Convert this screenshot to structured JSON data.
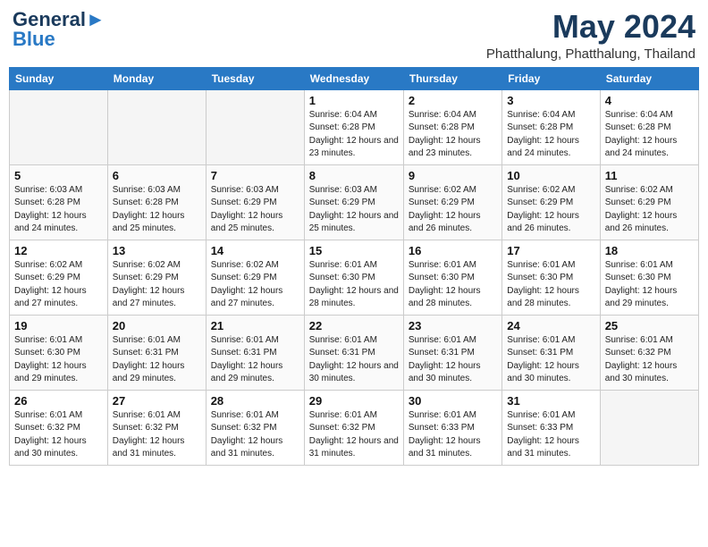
{
  "header": {
    "logo_general": "General",
    "logo_blue": "Blue",
    "month_year": "May 2024",
    "location": "Phatthalung, Phatthalung, Thailand"
  },
  "weekdays": [
    "Sunday",
    "Monday",
    "Tuesday",
    "Wednesday",
    "Thursday",
    "Friday",
    "Saturday"
  ],
  "weeks": [
    [
      {
        "day": "",
        "sunrise": "",
        "sunset": "",
        "daylight": "",
        "empty": true
      },
      {
        "day": "",
        "sunrise": "",
        "sunset": "",
        "daylight": "",
        "empty": true
      },
      {
        "day": "",
        "sunrise": "",
        "sunset": "",
        "daylight": "",
        "empty": true
      },
      {
        "day": "1",
        "sunrise": "Sunrise: 6:04 AM",
        "sunset": "Sunset: 6:28 PM",
        "daylight": "Daylight: 12 hours and 23 minutes."
      },
      {
        "day": "2",
        "sunrise": "Sunrise: 6:04 AM",
        "sunset": "Sunset: 6:28 PM",
        "daylight": "Daylight: 12 hours and 23 minutes."
      },
      {
        "day": "3",
        "sunrise": "Sunrise: 6:04 AM",
        "sunset": "Sunset: 6:28 PM",
        "daylight": "Daylight: 12 hours and 24 minutes."
      },
      {
        "day": "4",
        "sunrise": "Sunrise: 6:04 AM",
        "sunset": "Sunset: 6:28 PM",
        "daylight": "Daylight: 12 hours and 24 minutes."
      }
    ],
    [
      {
        "day": "5",
        "sunrise": "Sunrise: 6:03 AM",
        "sunset": "Sunset: 6:28 PM",
        "daylight": "Daylight: 12 hours and 24 minutes."
      },
      {
        "day": "6",
        "sunrise": "Sunrise: 6:03 AM",
        "sunset": "Sunset: 6:28 PM",
        "daylight": "Daylight: 12 hours and 25 minutes."
      },
      {
        "day": "7",
        "sunrise": "Sunrise: 6:03 AM",
        "sunset": "Sunset: 6:29 PM",
        "daylight": "Daylight: 12 hours and 25 minutes."
      },
      {
        "day": "8",
        "sunrise": "Sunrise: 6:03 AM",
        "sunset": "Sunset: 6:29 PM",
        "daylight": "Daylight: 12 hours and 25 minutes."
      },
      {
        "day": "9",
        "sunrise": "Sunrise: 6:02 AM",
        "sunset": "Sunset: 6:29 PM",
        "daylight": "Daylight: 12 hours and 26 minutes."
      },
      {
        "day": "10",
        "sunrise": "Sunrise: 6:02 AM",
        "sunset": "Sunset: 6:29 PM",
        "daylight": "Daylight: 12 hours and 26 minutes."
      },
      {
        "day": "11",
        "sunrise": "Sunrise: 6:02 AM",
        "sunset": "Sunset: 6:29 PM",
        "daylight": "Daylight: 12 hours and 26 minutes."
      }
    ],
    [
      {
        "day": "12",
        "sunrise": "Sunrise: 6:02 AM",
        "sunset": "Sunset: 6:29 PM",
        "daylight": "Daylight: 12 hours and 27 minutes."
      },
      {
        "day": "13",
        "sunrise": "Sunrise: 6:02 AM",
        "sunset": "Sunset: 6:29 PM",
        "daylight": "Daylight: 12 hours and 27 minutes."
      },
      {
        "day": "14",
        "sunrise": "Sunrise: 6:02 AM",
        "sunset": "Sunset: 6:29 PM",
        "daylight": "Daylight: 12 hours and 27 minutes."
      },
      {
        "day": "15",
        "sunrise": "Sunrise: 6:01 AM",
        "sunset": "Sunset: 6:30 PM",
        "daylight": "Daylight: 12 hours and 28 minutes."
      },
      {
        "day": "16",
        "sunrise": "Sunrise: 6:01 AM",
        "sunset": "Sunset: 6:30 PM",
        "daylight": "Daylight: 12 hours and 28 minutes."
      },
      {
        "day": "17",
        "sunrise": "Sunrise: 6:01 AM",
        "sunset": "Sunset: 6:30 PM",
        "daylight": "Daylight: 12 hours and 28 minutes."
      },
      {
        "day": "18",
        "sunrise": "Sunrise: 6:01 AM",
        "sunset": "Sunset: 6:30 PM",
        "daylight": "Daylight: 12 hours and 29 minutes."
      }
    ],
    [
      {
        "day": "19",
        "sunrise": "Sunrise: 6:01 AM",
        "sunset": "Sunset: 6:30 PM",
        "daylight": "Daylight: 12 hours and 29 minutes."
      },
      {
        "day": "20",
        "sunrise": "Sunrise: 6:01 AM",
        "sunset": "Sunset: 6:31 PM",
        "daylight": "Daylight: 12 hours and 29 minutes."
      },
      {
        "day": "21",
        "sunrise": "Sunrise: 6:01 AM",
        "sunset": "Sunset: 6:31 PM",
        "daylight": "Daylight: 12 hours and 29 minutes."
      },
      {
        "day": "22",
        "sunrise": "Sunrise: 6:01 AM",
        "sunset": "Sunset: 6:31 PM",
        "daylight": "Daylight: 12 hours and 30 minutes."
      },
      {
        "day": "23",
        "sunrise": "Sunrise: 6:01 AM",
        "sunset": "Sunset: 6:31 PM",
        "daylight": "Daylight: 12 hours and 30 minutes."
      },
      {
        "day": "24",
        "sunrise": "Sunrise: 6:01 AM",
        "sunset": "Sunset: 6:31 PM",
        "daylight": "Daylight: 12 hours and 30 minutes."
      },
      {
        "day": "25",
        "sunrise": "Sunrise: 6:01 AM",
        "sunset": "Sunset: 6:32 PM",
        "daylight": "Daylight: 12 hours and 30 minutes."
      }
    ],
    [
      {
        "day": "26",
        "sunrise": "Sunrise: 6:01 AM",
        "sunset": "Sunset: 6:32 PM",
        "daylight": "Daylight: 12 hours and 30 minutes."
      },
      {
        "day": "27",
        "sunrise": "Sunrise: 6:01 AM",
        "sunset": "Sunset: 6:32 PM",
        "daylight": "Daylight: 12 hours and 31 minutes."
      },
      {
        "day": "28",
        "sunrise": "Sunrise: 6:01 AM",
        "sunset": "Sunset: 6:32 PM",
        "daylight": "Daylight: 12 hours and 31 minutes."
      },
      {
        "day": "29",
        "sunrise": "Sunrise: 6:01 AM",
        "sunset": "Sunset: 6:32 PM",
        "daylight": "Daylight: 12 hours and 31 minutes."
      },
      {
        "day": "30",
        "sunrise": "Sunrise: 6:01 AM",
        "sunset": "Sunset: 6:33 PM",
        "daylight": "Daylight: 12 hours and 31 minutes."
      },
      {
        "day": "31",
        "sunrise": "Sunrise: 6:01 AM",
        "sunset": "Sunset: 6:33 PM",
        "daylight": "Daylight: 12 hours and 31 minutes."
      },
      {
        "day": "",
        "sunrise": "",
        "sunset": "",
        "daylight": "",
        "empty": true
      }
    ]
  ]
}
